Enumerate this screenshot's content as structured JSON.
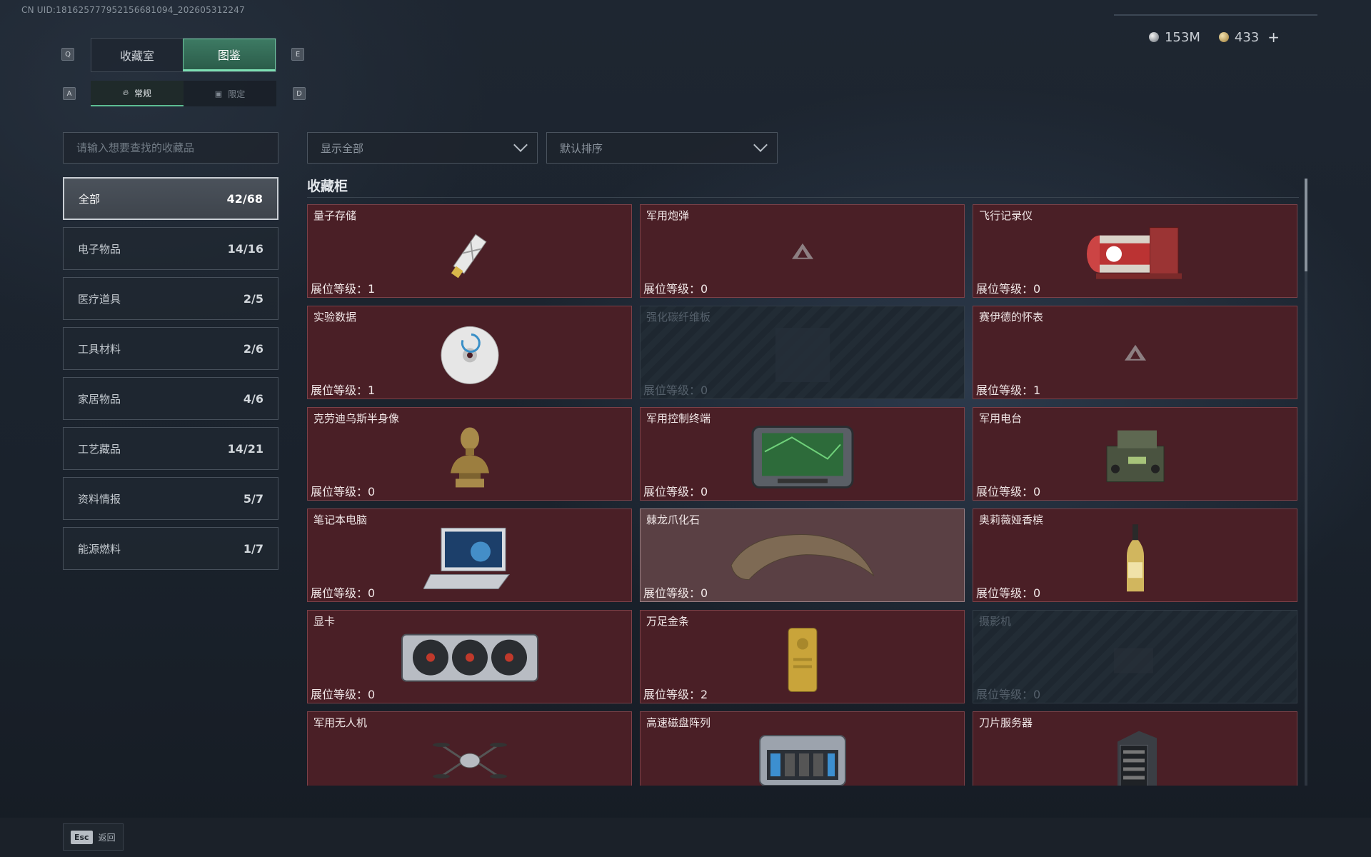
{
  "uid": "CN UID:1816257779521566810​94_202605312247",
  "currency": [
    {
      "icon": "silver-coin-icon",
      "value": "153M"
    },
    {
      "icon": "gold-coin-icon",
      "value": "433"
    }
  ],
  "currency_plus": "+",
  "keys": {
    "left_main": "Q",
    "right_main": "E",
    "left_sub": "A",
    "right_sub": "D"
  },
  "main_tabs": [
    {
      "label": "收藏室",
      "active": false
    },
    {
      "label": "图鉴",
      "active": true
    }
  ],
  "sub_tabs": [
    {
      "label": "常规",
      "icon": "flame-icon",
      "active": true
    },
    {
      "label": "限定",
      "icon": "image-icon",
      "active": false
    }
  ],
  "search": {
    "placeholder": "请输入想要查找的收藏品",
    "value": ""
  },
  "filter_dropdown": {
    "value": "显示全部"
  },
  "sort_dropdown": {
    "value": "默认排序"
  },
  "categories": [
    {
      "label": "全部",
      "count": "42/68",
      "active": true
    },
    {
      "label": "电子物品",
      "count": "14/16"
    },
    {
      "label": "医疗道具",
      "count": "2/5"
    },
    {
      "label": "工具材料",
      "count": "2/6"
    },
    {
      "label": "家居物品",
      "count": "4/6"
    },
    {
      "label": "工艺藏品",
      "count": "14/21"
    },
    {
      "label": "资料情报",
      "count": "5/7"
    },
    {
      "label": "能源燃料",
      "count": "1/7"
    }
  ],
  "section_title": "收藏柜",
  "level_prefix": "展位等级：",
  "items": [
    {
      "name": "量子存储",
      "level": "1",
      "state": "owned",
      "art": "usb"
    },
    {
      "name": "军用炮弹",
      "level": "0",
      "state": "owned",
      "art": "placeholder"
    },
    {
      "name": "飞行记录仪",
      "level": "0",
      "state": "owned",
      "art": "recorder"
    },
    {
      "name": "实验数据",
      "level": "1",
      "state": "owned",
      "art": "disc"
    },
    {
      "name": "强化碳纤维板",
      "level": "0",
      "state": "locked",
      "art": "panel"
    },
    {
      "name": "赛伊德的怀表",
      "level": "1",
      "state": "owned",
      "art": "placeholder"
    },
    {
      "name": "克劳迪乌斯半身像",
      "level": "0",
      "state": "owned",
      "art": "bust"
    },
    {
      "name": "军用控制终端",
      "level": "0",
      "state": "owned",
      "art": "terminal"
    },
    {
      "name": "军用电台",
      "level": "0",
      "state": "owned",
      "art": "radio"
    },
    {
      "name": "笔记本电脑",
      "level": "0",
      "state": "owned",
      "art": "laptop"
    },
    {
      "name": "棘龙爪化石",
      "level": "0",
      "state": "highlight",
      "art": "claw"
    },
    {
      "name": "奥莉薇娅香槟",
      "level": "0",
      "state": "owned",
      "art": "bottle"
    },
    {
      "name": "显卡",
      "level": "0",
      "state": "owned",
      "art": "gpu"
    },
    {
      "name": "万足金条",
      "level": "2",
      "state": "owned",
      "art": "goldbar"
    },
    {
      "name": "摄影机",
      "level": "0",
      "state": "locked",
      "art": "camera"
    },
    {
      "name": "军用无人机",
      "level": "",
      "state": "owned",
      "art": "drone"
    },
    {
      "name": "高速磁盘阵列",
      "level": "",
      "state": "owned",
      "art": "raid"
    },
    {
      "name": "刀片服务器",
      "level": "",
      "state": "owned",
      "art": "server"
    }
  ],
  "footer": {
    "key": "Esc",
    "label": "返回"
  }
}
